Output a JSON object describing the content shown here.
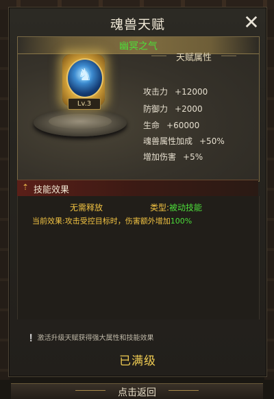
{
  "dialog": {
    "title": "魂兽天赋",
    "close_icon": "close-x"
  },
  "talent": {
    "name": "幽冥之气",
    "level_label": "Lv.3",
    "emblem_icon": "beast-head-orb-icon"
  },
  "attributes": {
    "header": "天赋属性",
    "rows": [
      {
        "label": "攻击力",
        "value": "+12000"
      },
      {
        "label": "防御力",
        "value": "+2000"
      },
      {
        "label": "生命",
        "value": "+60000"
      },
      {
        "label": "魂兽属性加成",
        "value": "+50%"
      },
      {
        "label": "增加伤害",
        "value": "+5%"
      }
    ]
  },
  "skill": {
    "header": "技能效果",
    "release": "无需释放",
    "type_label": "类型:",
    "type_value": "被动技能",
    "effect_label": "当前效果:",
    "effect_text": "攻击受控目标时，伤害额外增加",
    "effect_percent": "100%"
  },
  "footer": {
    "tip": "激活升级天赋获得强大属性和技能效果",
    "status": "已满级",
    "back_label": "点击返回"
  },
  "colors": {
    "accent_gold": "#f0cc52",
    "green": "#4ddf3a",
    "skill_red": "#5a1f18"
  }
}
